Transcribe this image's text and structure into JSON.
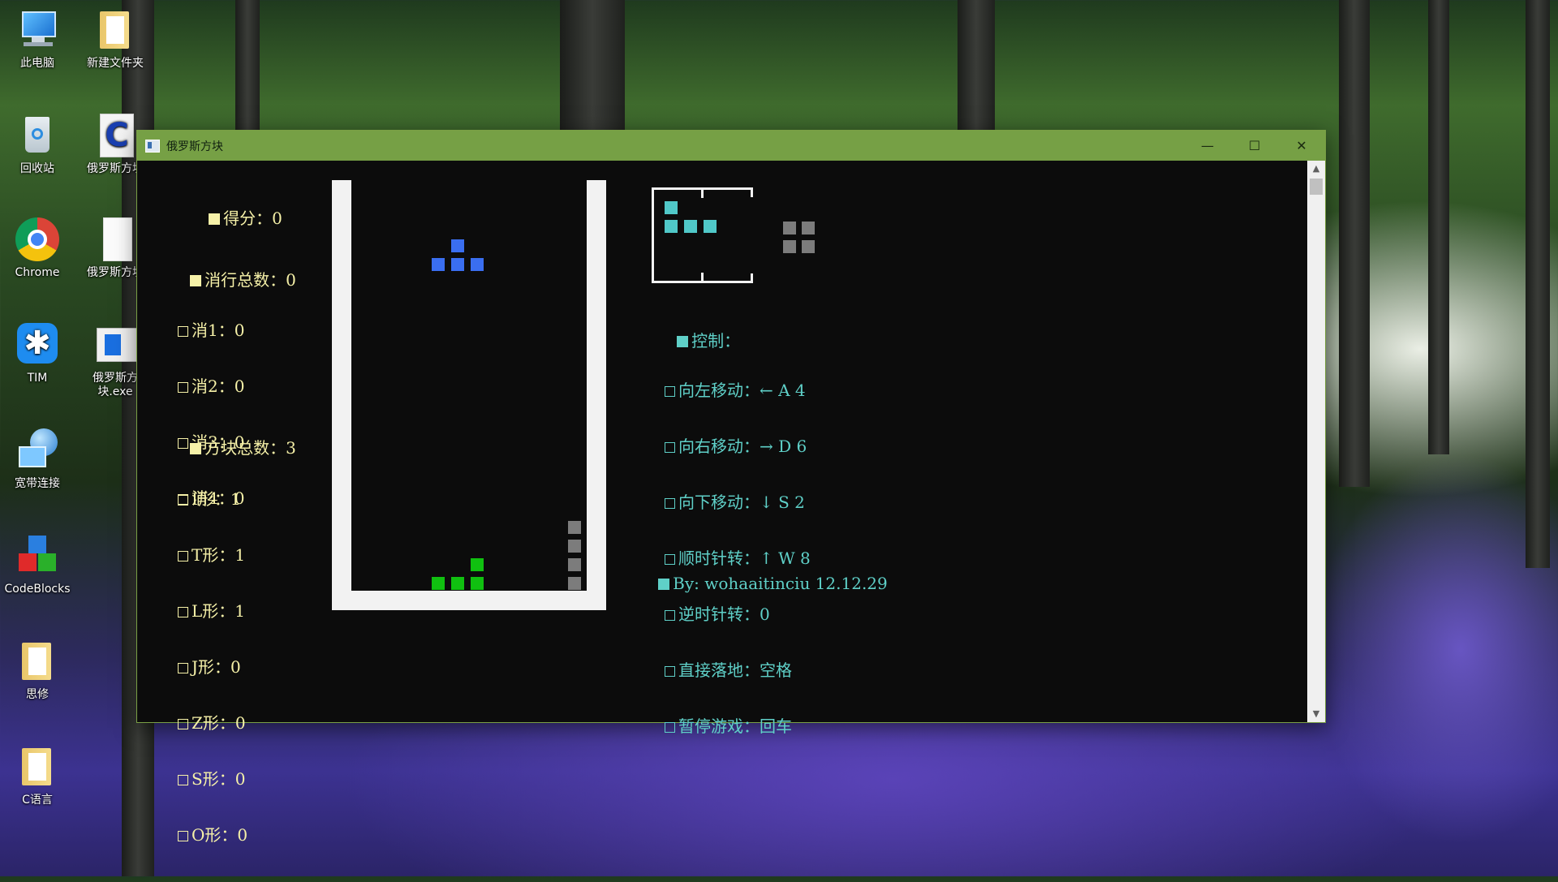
{
  "desktop": {
    "icons_col1": [
      {
        "label": "此电脑",
        "icon": "computer-icon"
      },
      {
        "label": "回收站",
        "icon": "recycle-bin-icon"
      },
      {
        "label": "Chrome",
        "icon": "chrome-icon"
      },
      {
        "label": "TIM",
        "icon": "tim-icon"
      },
      {
        "label": "宽带连接",
        "icon": "broadband-icon"
      },
      {
        "label": "CodeBlocks",
        "icon": "codeblocks-icon"
      },
      {
        "label": "思修",
        "icon": "folder-icon"
      },
      {
        "label": "C语言",
        "icon": "folder-icon"
      }
    ],
    "icons_col2": [
      {
        "label": "新建文件夹",
        "icon": "folder-icon"
      },
      {
        "label": "俄罗斯方块",
        "icon": "c-source-icon"
      },
      {
        "label": "俄罗斯方块",
        "icon": "file-icon"
      },
      {
        "label": "俄罗斯方块.exe",
        "icon": "exe-icon"
      }
    ]
  },
  "window": {
    "title": "俄罗斯方块",
    "buttons": {
      "minimize": "—",
      "maximize": "☐",
      "close": "✕"
    }
  },
  "stats": {
    "score_label": "得分：",
    "score": "0",
    "lines_label": "消行总数：",
    "lines": "0",
    "line_items": [
      {
        "label": "消1：",
        "value": "0"
      },
      {
        "label": "消2：",
        "value": "0"
      },
      {
        "label": "消3：",
        "value": "0"
      },
      {
        "label": "消4：",
        "value": "0"
      }
    ],
    "blocks_label": "方块总数：",
    "blocks": "3",
    "block_items": [
      {
        "label": "I形：",
        "value": "1"
      },
      {
        "label": "T形：",
        "value": "1"
      },
      {
        "label": "L形：",
        "value": "1"
      },
      {
        "label": "J形：",
        "value": "0"
      },
      {
        "label": "Z形：",
        "value": "0"
      },
      {
        "label": "S形：",
        "value": "0"
      },
      {
        "label": "O形：",
        "value": "0"
      }
    ]
  },
  "controls": {
    "heading": "控制：",
    "items": [
      {
        "label": "向左移动：",
        "keys": "← A 4"
      },
      {
        "label": "向右移动：",
        "keys": "→ D 6"
      },
      {
        "label": "向下移动：",
        "keys": "↓ S 2"
      },
      {
        "label": "顺时针转：",
        "keys": "↑ W 8"
      },
      {
        "label": "逆时针转：",
        "keys": "0"
      },
      {
        "label": "直接落地：",
        "keys": "空格"
      },
      {
        "label": "暂停游戏：",
        "keys": "回车"
      }
    ]
  },
  "credit": "By: wohaaitinciu 12.12.29",
  "colors": {
    "titlebar": "#76a045",
    "stat_text": "#f6f1a8",
    "control_text": "#5fd0c8",
    "falling_piece": "#3a6ef0",
    "landed_piece": "#10c010",
    "gray_piece": "#7c7c7c",
    "next_piece": "#50c8c8"
  }
}
